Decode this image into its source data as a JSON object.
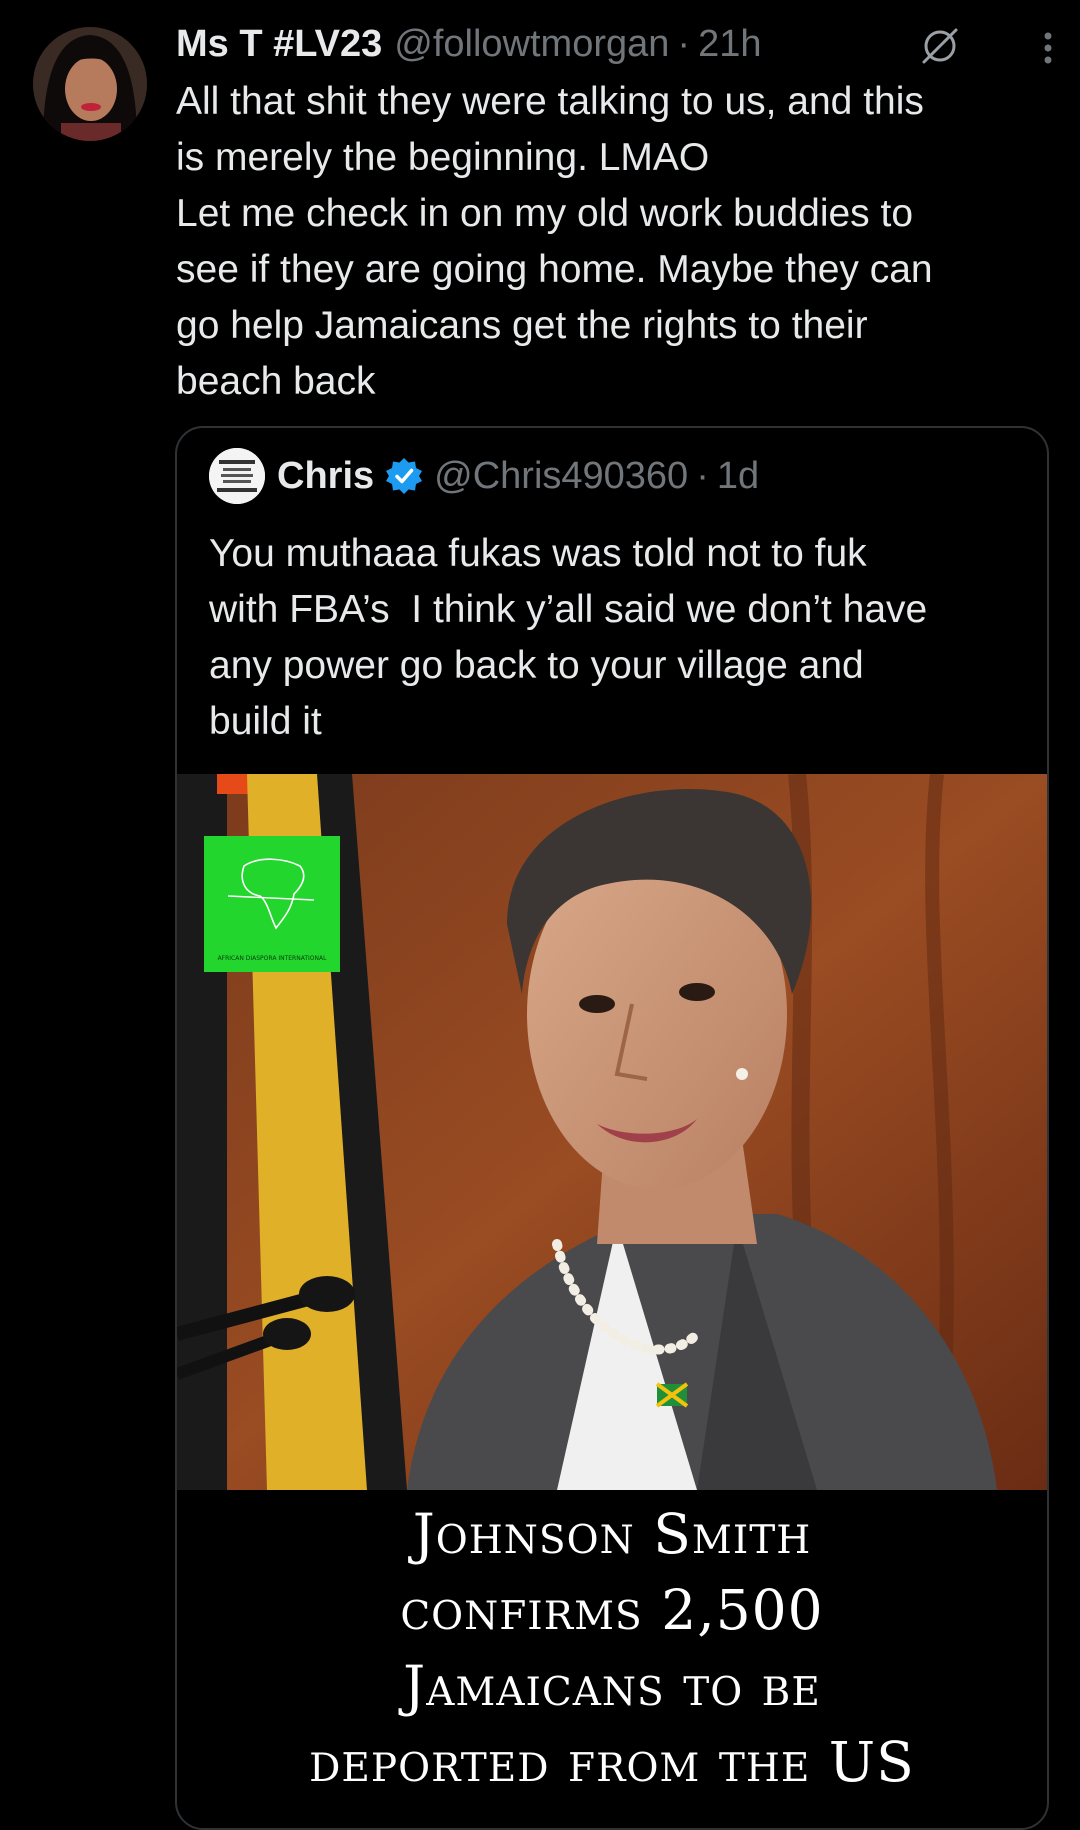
{
  "tweet": {
    "author_name": "Ms T #LV23",
    "handle": "@followtmorgan",
    "separator": "·",
    "time": "21h",
    "grok_icon": "grok-icon",
    "more_icon": "more-vertical-icon",
    "lines": [
      "All that shit they were talking to us, and this",
      "is merely the beginning. LMAO",
      "Let me check in on my old work buddies to",
      "see if they are going home. Maybe they can",
      "go help Jamaicans get the rights to their",
      "beach back"
    ]
  },
  "quote": {
    "author_name": "Chris",
    "verified_icon": "verified-badge-icon",
    "handle": "@Chris490360",
    "separator": "·",
    "time": "1d",
    "lines": [
      "You muthaaa fukas was told not to fuk",
      "with FBA’s  I think y’all said we don’t have",
      "any power go back to your village and",
      "build it"
    ],
    "media": {
      "logo_text": "AFRICAN DIASPORA INTERNATIONAL",
      "headline_lines": [
        "Johnson Smith",
        "confirms 2,500",
        "Jamaicans to be",
        "deported from the US"
      ]
    }
  },
  "colors": {
    "background": "#000000",
    "text_primary": "#e7e9ea",
    "text_secondary": "#71767b",
    "border": "#2f3336",
    "verified": "#1d9bf0"
  }
}
